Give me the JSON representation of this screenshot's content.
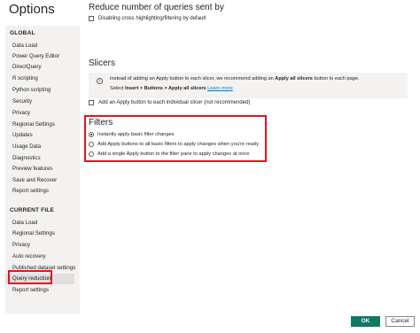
{
  "window": {
    "title": "Options"
  },
  "sidebar": {
    "global_heading": "GLOBAL",
    "global_items": [
      {
        "label": "Data Load"
      },
      {
        "label": "Power Query Editor"
      },
      {
        "label": "DirectQuery"
      },
      {
        "label": "R scripting"
      },
      {
        "label": "Python scripting"
      },
      {
        "label": "Security"
      },
      {
        "label": "Privacy"
      },
      {
        "label": "Regional Settings"
      },
      {
        "label": "Updates"
      },
      {
        "label": "Usage Data"
      },
      {
        "label": "Diagnostics"
      },
      {
        "label": "Preview features"
      },
      {
        "label": "Save and Recover"
      },
      {
        "label": "Report settings"
      }
    ],
    "file_heading": "CURRENT FILE",
    "file_items": [
      {
        "label": "Data Load"
      },
      {
        "label": "Regional Settings"
      },
      {
        "label": "Privacy"
      },
      {
        "label": "Auto recovery"
      },
      {
        "label": "Published dataset settings"
      },
      {
        "label": "Query reduction"
      },
      {
        "label": "Report settings"
      }
    ],
    "selected_item": "Query reduction"
  },
  "main": {
    "reduce_heading": "Reduce number of queries sent by",
    "disable_cross_highlight": {
      "label": "Disabling cross highlighting/filtering by default",
      "checked": false
    },
    "slicers_heading": "Slicers",
    "info": {
      "line1_a": "Instead of adding an Apply button to each slicer, we recommend adding an ",
      "line1_bold": "Apply all slicers",
      "line1_b": " button to each page.",
      "line2_a": "Select ",
      "line2_bold": "Insert > Buttons > Apply all slicers",
      "line2_link": "Learn more"
    },
    "slicer_apply": {
      "label": "Add an Apply button to each individual slicer (not recommended)",
      "checked": false
    },
    "filters_heading": "Filters",
    "filter_options": [
      {
        "label": "Instantly apply basic filter changes",
        "checked": true
      },
      {
        "label": "Add Apply buttons to all basic filters to apply changes when you're ready",
        "checked": false
      },
      {
        "label": "Add a single Apply button to the filter pane to apply changes at once",
        "checked": false
      }
    ]
  },
  "footer": {
    "ok_label": "OK",
    "cancel_label": "Cancel"
  },
  "colors": {
    "accent": "#117865",
    "highlight": "#e8101e",
    "link": "#0078d4"
  }
}
